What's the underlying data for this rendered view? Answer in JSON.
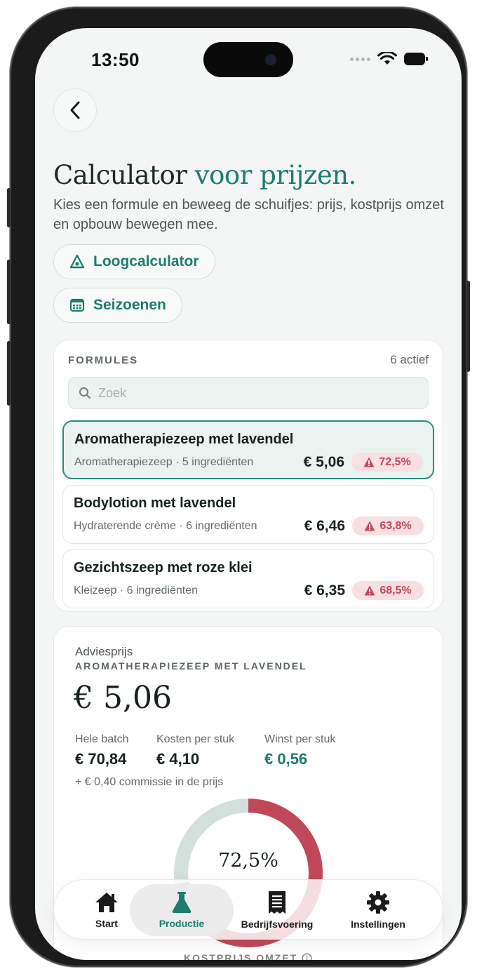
{
  "status": {
    "time": "13:50"
  },
  "header": {
    "title_main": "Calculator",
    "title_accent": "voor prijzen.",
    "subtitle": "Kies een formule en beweeg de schuifjes: prijs, kostprijs omzet en opbouw bewegen mee."
  },
  "actions": {
    "lye_calculator": "Loogcalculator",
    "seasons": "Seizoenen"
  },
  "formulas": {
    "heading": "FORMULES",
    "count": "6 actief",
    "search_placeholder": "Zoek",
    "items": [
      {
        "name": "Aromatherapiezeep met lavendel",
        "meta": "Aromatherapiezeep · 5 ingrediënten",
        "price": "€ 5,06",
        "margin": "72,5%"
      },
      {
        "name": "Bodylotion met lavendel",
        "meta": "Hydraterende crème · 6 ingrediënten",
        "price": "€ 6,46",
        "margin": "63,8%"
      },
      {
        "name": "Gezichtszeep met roze klei",
        "meta": "Kleizeep · 6 ingrediënten",
        "price": "€ 6,35",
        "margin": "68,5%"
      }
    ]
  },
  "advice": {
    "label": "Adviesprijs",
    "product": "AROMATHERAPIEZEEP MET LAVENDEL",
    "price": "€ 5,06",
    "stats": [
      {
        "label": "Hele batch",
        "value": "€ 70,84"
      },
      {
        "label": "Kosten per stuk",
        "value": "€ 4,10"
      },
      {
        "label": "Winst per stuk",
        "value": "€ 0,56"
      }
    ],
    "commission": "+ € 0,40 commissie in de prijs",
    "donut_percent_label": "72,5%",
    "donut_fraction": 0.725,
    "section_label": "KOSTPRIJS OMZET"
  },
  "tabs": [
    {
      "label": "Start",
      "icon": "home-icon"
    },
    {
      "label": "Productie",
      "icon": "flask-icon",
      "active": true
    },
    {
      "label": "Bedrijfsvoering",
      "icon": "receipt-icon"
    },
    {
      "label": "Instellingen",
      "icon": "gear-icon"
    }
  ],
  "colors": {
    "accent": "#1d7c6e",
    "warning": "#c0485a",
    "donut_track": "#d3dfdb"
  }
}
